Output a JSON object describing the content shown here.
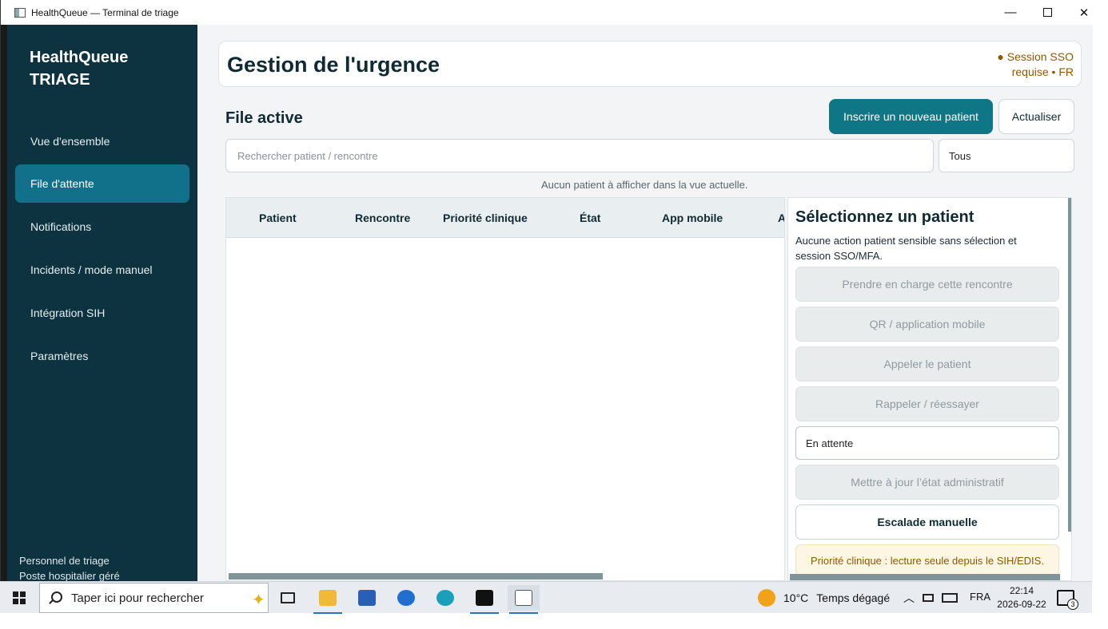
{
  "window": {
    "title": "HealthQueue — Terminal de triage",
    "min_glyph": "—",
    "close_glyph": "✕"
  },
  "sidebar": {
    "brand_line1": "HealthQueue",
    "brand_line2": "TRIAGE",
    "items": [
      {
        "label": "Vue d'ensemble",
        "active": false
      },
      {
        "label": "File d'attente",
        "active": true
      },
      {
        "label": "Notifications",
        "active": false
      },
      {
        "label": "Incidents / mode manuel",
        "active": false
      },
      {
        "label": "Intégration SIH",
        "active": false
      },
      {
        "label": "Paramètres",
        "active": false
      }
    ],
    "footer_line1": "Personnel de triage",
    "footer_line2": "Poste hospitalier géré"
  },
  "header": {
    "title": "Gestion de l'urgence",
    "session_line1": "● Session SSO",
    "session_line2": "requise • FR",
    "session_color": "#8a5a00"
  },
  "queue": {
    "title": "File active",
    "new_patient_label": "Inscrire un nouveau patient",
    "refresh_label": "Actualiser",
    "search_placeholder": "Rechercher patient / rencontre",
    "filter_value": "Tous",
    "empty_message": "Aucun patient à afficher dans la vue actuelle.",
    "columns": [
      "Patient",
      "Rencontre",
      "Priorité clinique",
      "État",
      "App mobile",
      "A"
    ]
  },
  "panel": {
    "title": "Sélectionnez un patient",
    "note": "Aucune action patient sensible sans sélection et session SSO/MFA.",
    "take_charge_label": "Prendre en charge cette rencontre",
    "qr_label": "QR / application mobile",
    "call_label": "Appeler le patient",
    "recall_label": "Rappeler / réessayer",
    "state_value": "En attente",
    "update_admin_label": "Mettre à jour l’état administratif",
    "escalate_label": "Escalade manuelle",
    "priority_note": "Priorité clinique : lecture seule depuis le SIH/EDIS."
  },
  "taskbar": {
    "search_placeholder": "Taper ici pour rechercher",
    "weather_temp": "10°C",
    "weather_text": "Temps dégagé",
    "language": "FRA",
    "time": "22:14",
    "date": "2026-09-22",
    "notification_count": "3"
  },
  "colors": {
    "sidebar_bg": "#0d3340",
    "sidebar_active": "#12718a",
    "primary_button": "#0f7686",
    "accent_warning": "#8a5a00"
  }
}
